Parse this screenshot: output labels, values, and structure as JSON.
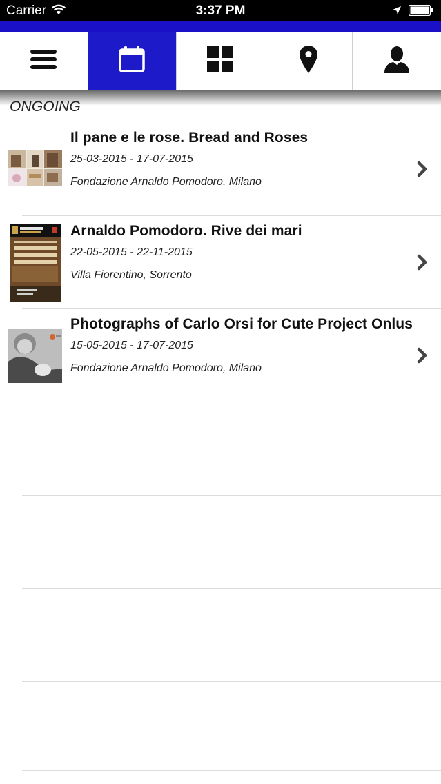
{
  "status_bar": {
    "carrier": "Carrier",
    "time": "3:37 PM"
  },
  "nav": {
    "tabs": [
      {
        "icon": "menu-icon"
      },
      {
        "icon": "calendar-icon",
        "active": true
      },
      {
        "icon": "grid-icon"
      },
      {
        "icon": "location-pin-icon"
      },
      {
        "icon": "user-icon"
      }
    ],
    "accent_color": "#1d1ac9"
  },
  "section": {
    "title": "ONGOING"
  },
  "events": [
    {
      "title": "Il pane e le rose. Bread and Roses",
      "dates": "25-03-2015 - 17-07-2015",
      "place": "Fondazione Arnaldo Pomodoro, Milano"
    },
    {
      "title": "Arnaldo Pomodoro. Rive dei mari",
      "dates": "22-05-2015 - 22-11-2015",
      "place": "Villa Fiorentino, Sorrento"
    },
    {
      "title": "Photographs of Carlo Orsi for Cute Project Onlus",
      "dates": "15-05-2015 - 17-07-2015",
      "place": "Fondazione Arnaldo Pomodoro, Milano"
    }
  ]
}
